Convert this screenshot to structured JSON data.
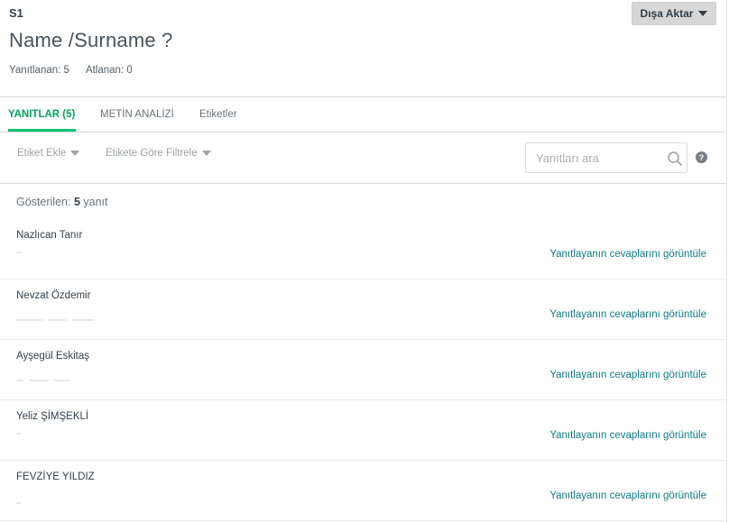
{
  "header": {
    "question_number": "S1",
    "question_title": "Name /Surname ?",
    "export_label": "Dışa Aktar",
    "stats": {
      "answered": "Yanıtlanan: 5",
      "skipped": "Atlanan: 0"
    }
  },
  "tabs": [
    {
      "label": "YANITLAR (5)",
      "active": true
    },
    {
      "label": "METİN ANALİZİ",
      "active": false
    },
    {
      "label": "Etiketler",
      "active": false
    }
  ],
  "toolbar": {
    "add_tag": "Etiket Ekle",
    "filter_by_tag": "Etikete Göre Filtrele",
    "search_placeholder": "Yanıtları ara",
    "help": "?"
  },
  "showing": {
    "prefix": "Gösterilen:",
    "count": "5",
    "suffix": "yanıt"
  },
  "responses": [
    {
      "name": "Nazlıcan Tanır",
      "link": "Yanıtlayanın cevaplarını görüntüle"
    },
    {
      "name": "Nevzat Özdemir",
      "link": "Yanıtlayanın cevaplarını görüntüle"
    },
    {
      "name": "Ayşegül Eskitaş",
      "link": "Yanıtlayanın cevaplarını görüntüle"
    },
    {
      "name": "Yeliz ŞİMŞEKLİ",
      "link": "Yanıtlayanın cevaplarını görüntüle"
    },
    {
      "name": "FEVZİYE YILDIZ",
      "link": "Yanıtlayanın cevaplarını görüntüle"
    }
  ],
  "colors": {
    "accent": "#00bf6f",
    "link": "#0f7b86",
    "export_bg": "#d7d7d7"
  }
}
